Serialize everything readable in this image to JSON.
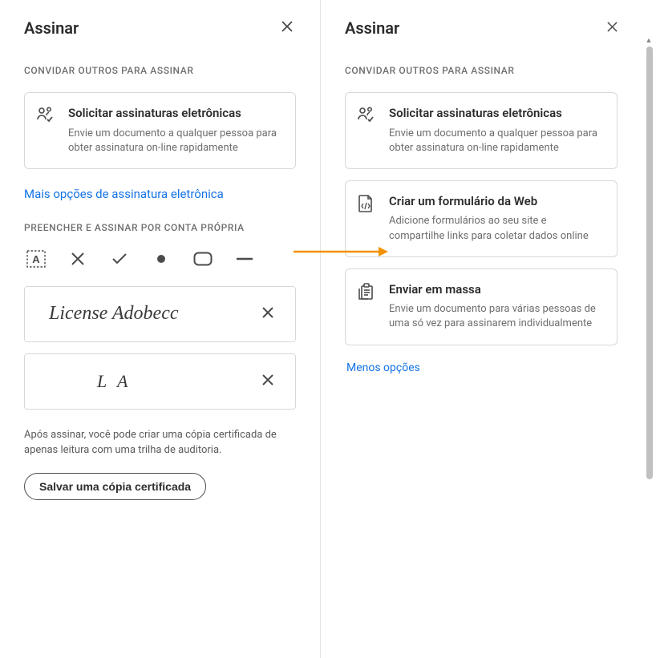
{
  "left": {
    "title": "Assinar",
    "invite_label": "CONVIDAR OUTROS PARA ASSINAR",
    "card1": {
      "title": "Solicitar assinaturas eletrônicas",
      "desc": "Envie um documento a qualquer pessoa para obter assinatura on-line rapidamente"
    },
    "more_link": "Mais opções de assinatura eletrônica",
    "self_label": "PREENCHER E ASSINAR POR CONTA PRÓPRIA",
    "signature_full": "License Adobecc",
    "signature_initials": "L A",
    "footer": "Após assinar, você pode criar uma cópia certificada de apenas leitura com uma trilha de auditoria.",
    "save_btn": "Salvar uma cópia certificada"
  },
  "right": {
    "title": "Assinar",
    "invite_label": "CONVIDAR OUTROS PARA ASSINAR",
    "card1": {
      "title": "Solicitar assinaturas eletrônicas",
      "desc": "Envie um documento a qualquer pessoa para obter assinatura on-line rapidamente"
    },
    "card2": {
      "title": "Criar um formulário da Web",
      "desc": "Adicione formulários ao seu site e compartilhe links para coletar dados online"
    },
    "card3": {
      "title": "Enviar em massa",
      "desc": "Envie um documento para várias pessoas de uma só vez para assinarem individualmente"
    },
    "less_link": "Menos opções"
  }
}
